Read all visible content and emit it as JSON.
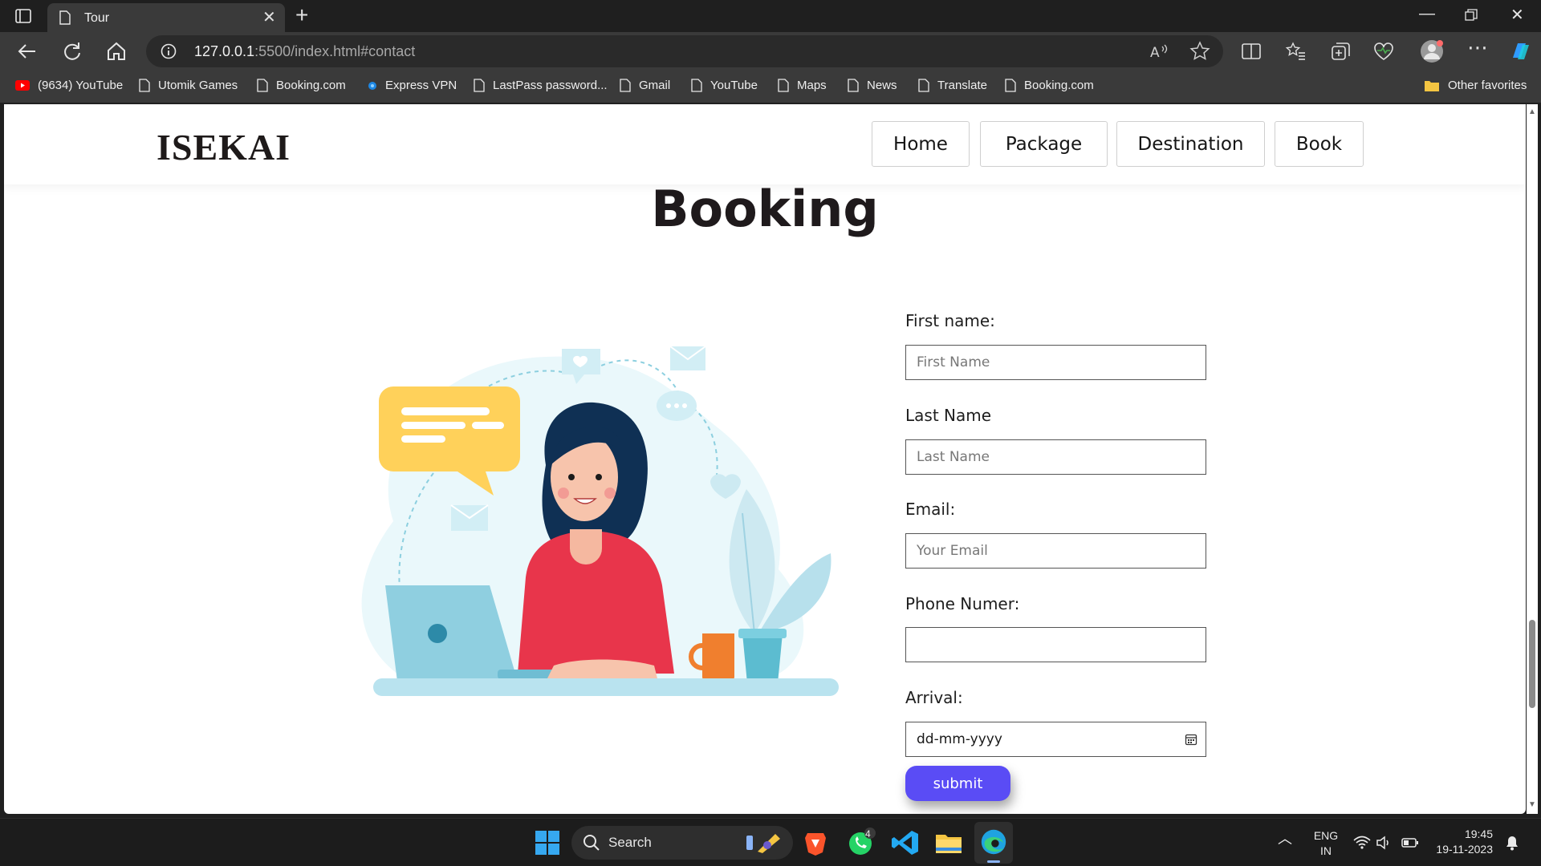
{
  "browser": {
    "tab_title": "Tour",
    "url_host": "127.0.0.1",
    "url_rest": ":5500/index.html#contact",
    "bookmarks": [
      "(9634) YouTube",
      "Utomik Games",
      "Booking.com",
      "Express VPN",
      "LastPass password...",
      "Gmail",
      "YouTube",
      "Maps",
      "News",
      "Translate",
      "Booking.com"
    ],
    "other_favorites": "Other favorites"
  },
  "site": {
    "logo": "ISEKAI",
    "nav": [
      "Home",
      "Package",
      "Destination",
      "Book"
    ],
    "heading": "Booking",
    "form": {
      "first_name_label": "First name:",
      "first_name_placeholder": "First Name",
      "last_name_label": "Last Name",
      "last_name_placeholder": "Last Name",
      "email_label": "Email:",
      "email_placeholder": "Your Email",
      "phone_label": "Phone Numer:",
      "phone_placeholder": "",
      "arrival_label": "Arrival:",
      "arrival_value": "dd-mm-yyyy",
      "submit_label": "submit"
    }
  },
  "taskbar": {
    "search_label": "Search",
    "whatsapp_badge": "4",
    "lang_top": "ENG",
    "lang_bottom": "IN",
    "time": "19:45",
    "date": "19-11-2023"
  },
  "colors": {
    "accent_button": "#5a4cf5",
    "heading_text": "#1f1a1c",
    "chat_bubble": "#ffd15a",
    "sweater": "#e8354b"
  }
}
